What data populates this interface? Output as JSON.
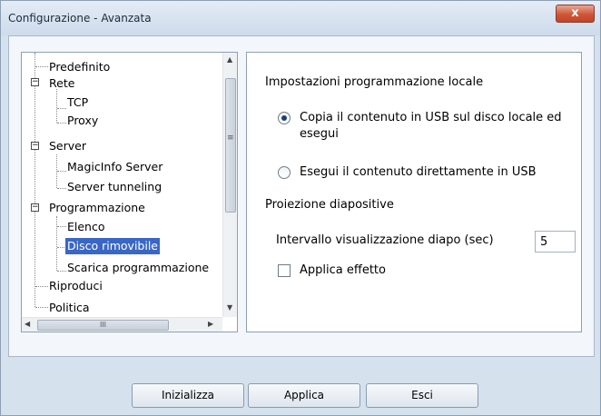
{
  "window": {
    "title": "Configurazione - Avanzata",
    "close_glyph": "x"
  },
  "tree": {
    "items": [
      {
        "label": "Predefinito"
      },
      {
        "label": "Rete",
        "expander": "−"
      },
      {
        "label": "TCP"
      },
      {
        "label": "Proxy"
      },
      {
        "label": "Server",
        "expander": "−"
      },
      {
        "label": "MagicInfo Server"
      },
      {
        "label": "Server tunneling"
      },
      {
        "label": "Programmazione",
        "expander": "−"
      },
      {
        "label": "Elenco"
      },
      {
        "label": "Disco rimovibile",
        "selected": true
      },
      {
        "label": "Scarica programmazione"
      },
      {
        "label": "Riproduci"
      },
      {
        "label": "Politica"
      }
    ],
    "scroll_up_glyph": "▲",
    "scroll_down_glyph": "▼",
    "scroll_left_glyph": "◀",
    "scroll_right_glyph": "▶",
    "hthumb_grip": "III",
    "vthumb_grip": "≡"
  },
  "settings": {
    "local_schedule_heading": "Impostazioni programmazione locale",
    "radio_copy_line1": "Copia il contenuto in USB sul disco locale ed",
    "radio_copy_line2": "esegui",
    "radio_copy_selected": true,
    "radio_direct": "Esegui il contenuto direttamente in USB",
    "slideshow_heading": "Proiezione diapositive",
    "interval_label": "Intervallo visualizzazione diapo (sec)",
    "interval_value": "5",
    "apply_effect_label": "Applica effetto",
    "apply_effect_checked": false
  },
  "buttons": {
    "reset_label": "Inizializza",
    "apply_label": "Applica",
    "exit_label": "Esci"
  }
}
